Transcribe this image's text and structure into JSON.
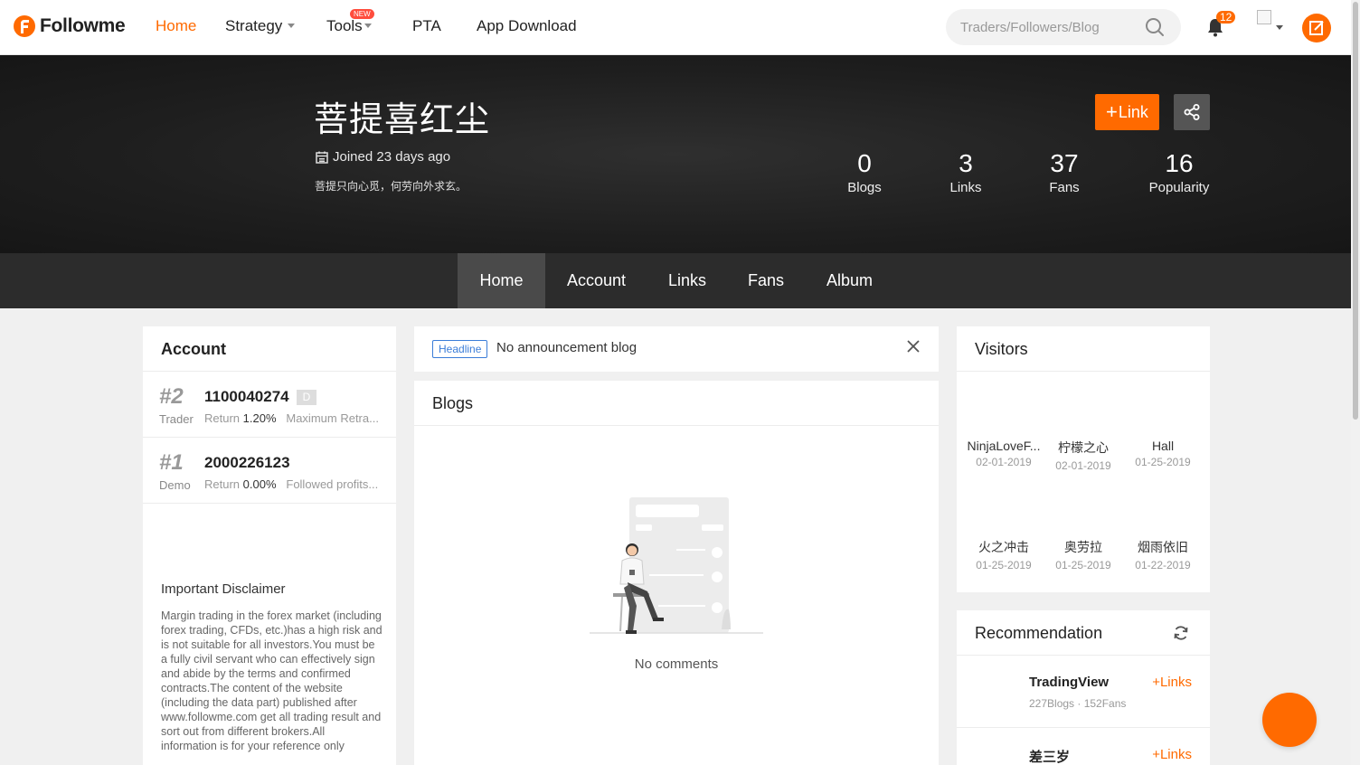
{
  "brand": {
    "name": "Followme",
    "accent": "#ff6a00"
  },
  "nav": {
    "home": "Home",
    "strategy": "Strategy",
    "tools": "Tools",
    "tools_badge": "NEW",
    "pta": "PTA",
    "app_download": "App Download"
  },
  "search": {
    "placeholder": "Traders/Followers/Blog"
  },
  "notifications": {
    "count": "12"
  },
  "profile": {
    "name": "菩提喜红尘",
    "joined": "Joined 23 days ago",
    "motto": "菩提只向心觅，何劳向外求玄。",
    "link_button": "Link",
    "stats": [
      {
        "value": "0",
        "label": "Blogs"
      },
      {
        "value": "3",
        "label": "Links"
      },
      {
        "value": "37",
        "label": "Fans"
      },
      {
        "value": "16",
        "label": "Popularity"
      }
    ]
  },
  "tabs": [
    "Home",
    "Account",
    "Links",
    "Fans",
    "Album"
  ],
  "account": {
    "title": "Account",
    "rows": [
      {
        "rank": "#2",
        "type": "Trader",
        "number": "1100040274",
        "tag": "D",
        "return_label": "Return",
        "return_value": "1.20%",
        "extra": "Maximum Retra..."
      },
      {
        "rank": "#1",
        "type": "Demo",
        "number": "2000226123",
        "tag": "",
        "return_label": "Return",
        "return_value": "0.00%",
        "extra": "Followed profits..."
      }
    ],
    "disclaimer_title": "Important Disclaimer",
    "disclaimer_text": "Margin trading in the forex market (including forex trading, CFDs, etc.)has a high risk and is not suitable for all investors.You must be a fully civil servant who can effectively sign and abide by the terms and confirmed contracts.The content of the website (including the data part) published after www.followme.com get all trading result and sort out from different brokers.All information is for your reference only"
  },
  "headline": {
    "tag": "Headline",
    "text": "No announcement blog"
  },
  "blogs": {
    "title": "Blogs",
    "empty": "No comments"
  },
  "visitors": {
    "title": "Visitors",
    "items": [
      {
        "name": "NinjaLoveF...",
        "date": "02-01-2019"
      },
      {
        "name": "柠檬之心",
        "date": "02-01-2019"
      },
      {
        "name": "Hall",
        "date": "01-25-2019"
      },
      {
        "name": "火之冲击",
        "date": "01-25-2019"
      },
      {
        "name": "奥劳拉",
        "date": "01-25-2019"
      },
      {
        "name": "烟雨依旧",
        "date": "01-22-2019"
      }
    ]
  },
  "recommendation": {
    "title": "Recommendation",
    "items": [
      {
        "name": "TradingView",
        "meta": "227Blogs · 152Fans",
        "action": "Links"
      },
      {
        "name": "差三岁",
        "meta": "",
        "action": "Links"
      }
    ]
  }
}
